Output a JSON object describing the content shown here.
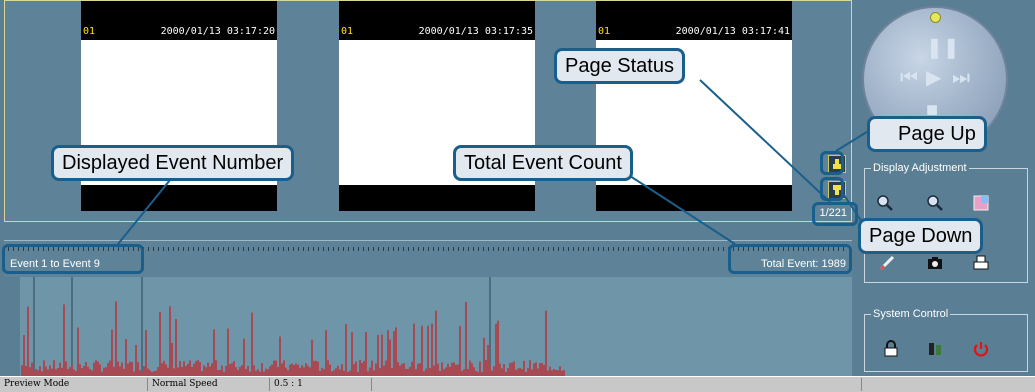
{
  "cameras": [
    {
      "channel": "01",
      "timestamp": "2000/01/13 03:17:20"
    },
    {
      "channel": "01",
      "timestamp": "2000/01/13 03:17:35"
    },
    {
      "channel": "01",
      "timestamp": "2000/01/13 03:17:41"
    }
  ],
  "page_status": "1/221",
  "event_bar": {
    "range": "Event 1 to Event 9",
    "total": "Total Event: 1989"
  },
  "panel": {
    "display_adjustment": "Display Adjustment",
    "system_control": "System Control"
  },
  "status_bar": {
    "mode": "Preview Mode",
    "speed": "Normal Speed",
    "ratio": "0.5 : 1"
  },
  "callouts": {
    "page_status": "Page Status",
    "page_up": "Page Up",
    "page_down": "Page Down",
    "displayed_event_number": "Displayed Event Number",
    "total_event_count": "Total Event Count"
  },
  "icons": {
    "zoom_in": "magnifier-icon",
    "zoom_out": "magnifier-icon",
    "color": "color-adjust-icon",
    "note": "pen-icon",
    "snapshot": "camera-icon",
    "print": "printer-icon",
    "lock": "lock-icon",
    "config": "tools-icon",
    "power": "power-icon"
  },
  "colors": {
    "accent": "#1a5f8c",
    "histogram_bar": "#e00000",
    "background": "#5a7f94"
  }
}
